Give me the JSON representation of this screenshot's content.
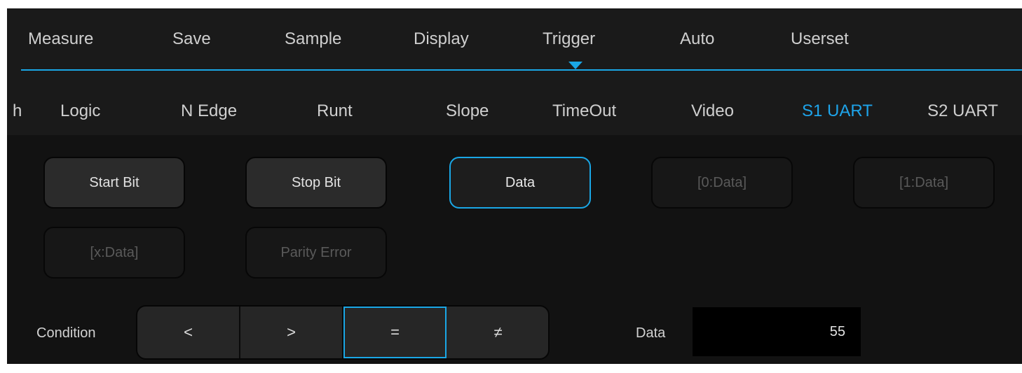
{
  "main_tabs": [
    {
      "label": "Measure"
    },
    {
      "label": "Save"
    },
    {
      "label": "Sample"
    },
    {
      "label": "Display"
    },
    {
      "label": "Trigger",
      "active": true
    },
    {
      "label": "Auto"
    },
    {
      "label": "Userset"
    }
  ],
  "sub_tabs": [
    {
      "label": "h"
    },
    {
      "label": "Logic"
    },
    {
      "label": "N Edge"
    },
    {
      "label": "Runt"
    },
    {
      "label": "Slope"
    },
    {
      "label": "TimeOut"
    },
    {
      "label": "Video"
    },
    {
      "label": "S1 UART",
      "active": true
    },
    {
      "label": "S2 UART"
    }
  ],
  "trigger_options": [
    {
      "label": "Start Bit",
      "state": "enabled"
    },
    {
      "label": "Stop Bit",
      "state": "enabled"
    },
    {
      "label": "Data",
      "state": "selected"
    },
    {
      "label": "[0:Data]",
      "state": "disabled"
    },
    {
      "label": "[1:Data]",
      "state": "disabled"
    },
    {
      "label": "[x:Data]",
      "state": "disabled"
    },
    {
      "label": "Parity Error",
      "state": "disabled"
    }
  ],
  "condition": {
    "label": "Condition",
    "options": [
      "<",
      ">",
      "=",
      "≠"
    ],
    "selected": "="
  },
  "data_field": {
    "label": "Data",
    "value": "55"
  },
  "colors": {
    "accent": "#1aa7e6",
    "background": "#141414",
    "text": "#cfcfcf",
    "disabled_text": "#5a5a5a"
  }
}
